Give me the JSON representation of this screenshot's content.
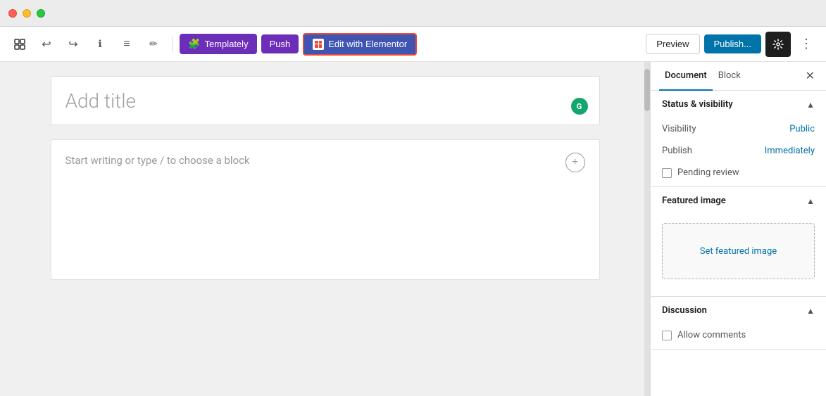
{
  "titlebar": {
    "buttons": [
      "close",
      "minimize",
      "maximize"
    ]
  },
  "toolbar": {
    "add_label": "+",
    "undo_label": "↩",
    "redo_label": "↪",
    "info_label": "ℹ",
    "list_label": "≡",
    "edit_label": "✏",
    "templately_label": "Templately",
    "push_label": "Push",
    "elementor_label": "Edit with Elementor",
    "preview_label": "Preview",
    "publish_label": "Publish...",
    "settings_label": "⚙",
    "more_label": "⋮"
  },
  "editor": {
    "title_placeholder": "Add title",
    "body_placeholder": "Start writing or type / to choose a block",
    "grammarly_label": "G"
  },
  "sidebar": {
    "tab_document": "Document",
    "tab_block": "Block",
    "close_label": "✕",
    "status_visibility": {
      "section_title": "Status & visibility",
      "visibility_label": "Visibility",
      "visibility_value": "Public",
      "publish_label": "Publish",
      "publish_value": "Immediately",
      "pending_review_label": "Pending review"
    },
    "featured_image": {
      "section_title": "Featured image",
      "set_image_label": "Set featured image"
    },
    "discussion": {
      "section_title": "Discussion",
      "allow_comments_label": "Allow comments"
    }
  }
}
